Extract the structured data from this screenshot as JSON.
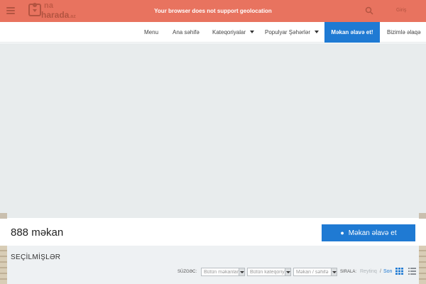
{
  "header": {
    "logo_line1": "na",
    "logo_line2": "harada",
    "logo_suffix": ".az",
    "geo_message": "Your browser does not support geolocation",
    "login_label": "Giriş",
    "icons": [
      "menu-icon",
      "search-icon",
      "map-pin-icon"
    ]
  },
  "nav": {
    "items": [
      {
        "label": "Menu"
      },
      {
        "label": "Ana səhifə"
      },
      {
        "label": "Kateqoriyalar"
      },
      {
        "label": "Populyar Şəhərlər"
      }
    ],
    "cta_label": "Məkan əlavə et!",
    "contact_label": "Bizimlə əlaqə"
  },
  "listing": {
    "count_text": "888 məkan",
    "add_button_label": "Məkan əlavə et"
  },
  "featured": {
    "title": "SEÇİLMİŞLƏR",
    "filter_label": "SÜZGƏC:",
    "filters": [
      {
        "value": "Bütün məkanlar"
      },
      {
        "value": "Bütün kateqoriyalar"
      },
      {
        "value": "Məkan / səhifə"
      }
    ],
    "sort_label": "SIRALA:",
    "sort_options": [
      {
        "label": "Reytinq"
      },
      {
        "label": "Son"
      }
    ],
    "sort_separator": "/"
  },
  "colors": {
    "topbar": "#e8735f",
    "primary": "#1f7ad3",
    "map_bg": "#e8eced"
  }
}
